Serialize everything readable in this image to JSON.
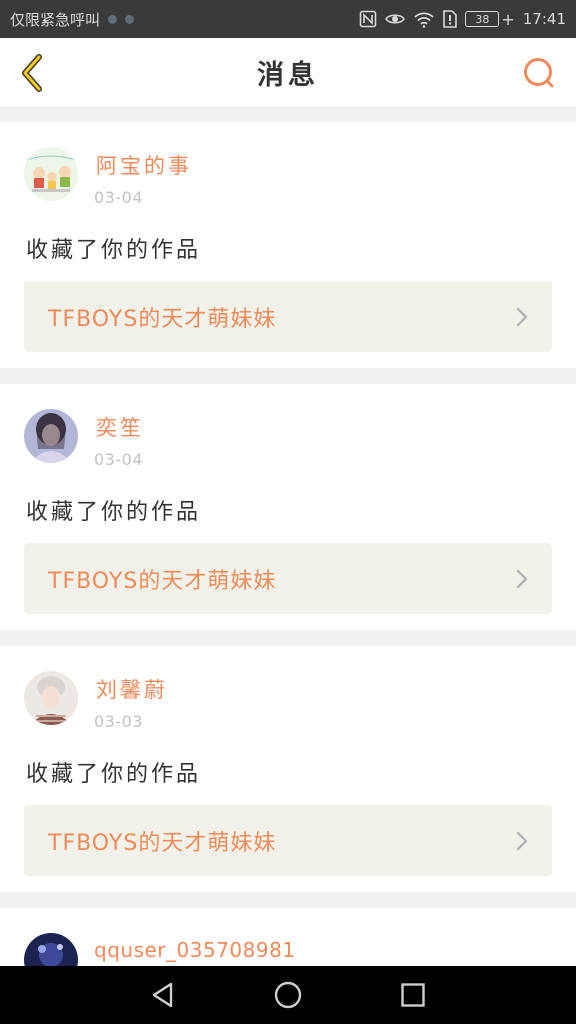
{
  "status_bar": {
    "carrier_text": "仅限紧急呼叫",
    "battery": "38",
    "time": "17:41"
  },
  "header": {
    "title": "消息",
    "back_icon": "chevron-left-icon",
    "search_icon": "search-icon"
  },
  "colors": {
    "accent": "#ef8a5a",
    "back_icon": "#f5c518",
    "card_link_bg": "#f3f2ea"
  },
  "notifications": [
    {
      "user": "阿宝的事",
      "date": "03-04",
      "action": "收藏了你的作品",
      "work_title": "TFBOYS的天才萌妹妹"
    },
    {
      "user": "奕笙",
      "date": "03-04",
      "action": "收藏了你的作品",
      "work_title": "TFBOYS的天才萌妹妹"
    },
    {
      "user": "刘馨蔚",
      "date": "03-03",
      "action": "收藏了你的作品",
      "work_title": "TFBOYS的天才萌妹妹"
    },
    {
      "user": "qquser_035708981"
    }
  ],
  "nav": {
    "back": "back-triangle-icon",
    "home": "home-circle-icon",
    "recents": "recents-square-icon"
  }
}
